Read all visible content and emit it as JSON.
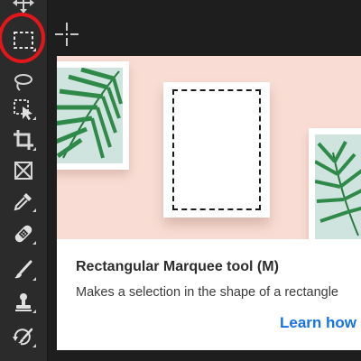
{
  "toolbar": {
    "tools": [
      {
        "name": "move-tool",
        "icon": "move-icon"
      },
      {
        "name": "rectangular-marquee-tool",
        "icon": "rectangular-marquee-icon",
        "highlighted": true
      },
      {
        "name": "lasso-tool",
        "icon": "lasso-icon"
      },
      {
        "name": "object-selection-tool",
        "icon": "object-selection-icon"
      },
      {
        "name": "crop-tool",
        "icon": "crop-icon"
      },
      {
        "name": "frame-tool",
        "icon": "frame-icon"
      },
      {
        "name": "eyedropper-tool",
        "icon": "eyedropper-icon"
      },
      {
        "name": "healing-brush-tool",
        "icon": "bandage-icon"
      },
      {
        "name": "brush-tool",
        "icon": "brush-icon"
      },
      {
        "name": "clone-stamp-tool",
        "icon": "stamp-icon"
      },
      {
        "name": "history-brush-tool",
        "icon": "history-brush-icon"
      }
    ],
    "highlight_color": "#e3161b"
  },
  "tooltip": {
    "title": "Rectangular Marquee tool (M)",
    "description": "Makes a selection in the shape of a rectangle",
    "link": "Learn how"
  },
  "colors": {
    "toolbar_bg": "#2b2b2b",
    "preview_bg": "#f9ddd4",
    "link": "#1473e6",
    "leaf": "#2f8a4a"
  }
}
